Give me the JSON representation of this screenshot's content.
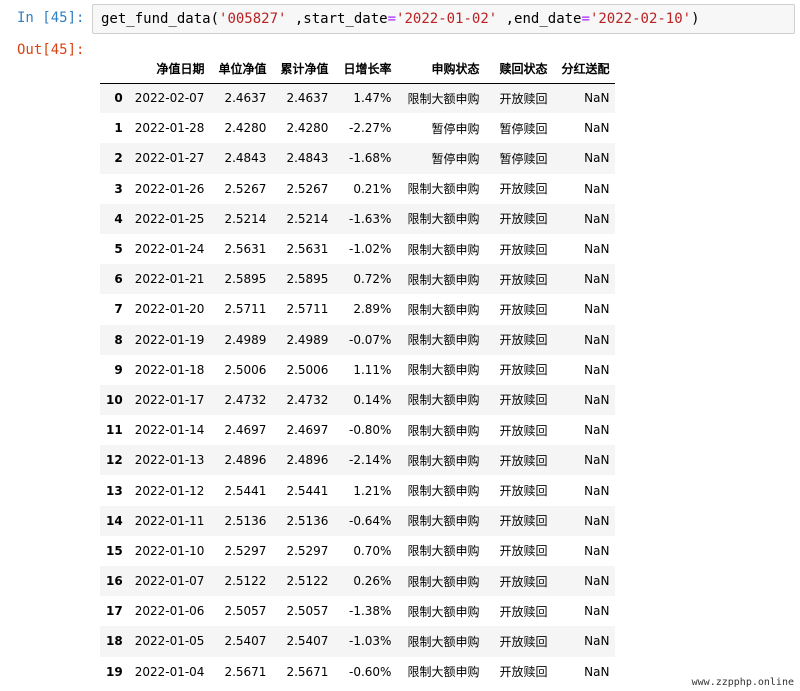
{
  "input_cell": {
    "prompt": "In [45]:",
    "code": {
      "func": "get_fund_data(",
      "arg1": "'005827'",
      "sep1": " ,start_date",
      "eq1": "=",
      "arg2": "'2022-01-02'",
      "sep2": " ,end_date",
      "eq2": "=",
      "arg3": "'2022-02-10'",
      "close": ")"
    }
  },
  "output_cell": {
    "prompt": "Out[45]:"
  },
  "table": {
    "columns": [
      "",
      "净值日期",
      "单位净值",
      "累计净值",
      "日增长率",
      "申购状态",
      "赎回状态",
      "分红送配"
    ],
    "rows": [
      [
        "0",
        "2022-02-07",
        "2.4637",
        "2.4637",
        "1.47%",
        "限制大额申购",
        "开放赎回",
        "NaN"
      ],
      [
        "1",
        "2022-01-28",
        "2.4280",
        "2.4280",
        "-2.27%",
        "暂停申购",
        "暂停赎回",
        "NaN"
      ],
      [
        "2",
        "2022-01-27",
        "2.4843",
        "2.4843",
        "-1.68%",
        "暂停申购",
        "暂停赎回",
        "NaN"
      ],
      [
        "3",
        "2022-01-26",
        "2.5267",
        "2.5267",
        "0.21%",
        "限制大额申购",
        "开放赎回",
        "NaN"
      ],
      [
        "4",
        "2022-01-25",
        "2.5214",
        "2.5214",
        "-1.63%",
        "限制大额申购",
        "开放赎回",
        "NaN"
      ],
      [
        "5",
        "2022-01-24",
        "2.5631",
        "2.5631",
        "-1.02%",
        "限制大额申购",
        "开放赎回",
        "NaN"
      ],
      [
        "6",
        "2022-01-21",
        "2.5895",
        "2.5895",
        "0.72%",
        "限制大额申购",
        "开放赎回",
        "NaN"
      ],
      [
        "7",
        "2022-01-20",
        "2.5711",
        "2.5711",
        "2.89%",
        "限制大额申购",
        "开放赎回",
        "NaN"
      ],
      [
        "8",
        "2022-01-19",
        "2.4989",
        "2.4989",
        "-0.07%",
        "限制大额申购",
        "开放赎回",
        "NaN"
      ],
      [
        "9",
        "2022-01-18",
        "2.5006",
        "2.5006",
        "1.11%",
        "限制大额申购",
        "开放赎回",
        "NaN"
      ],
      [
        "10",
        "2022-01-17",
        "2.4732",
        "2.4732",
        "0.14%",
        "限制大额申购",
        "开放赎回",
        "NaN"
      ],
      [
        "11",
        "2022-01-14",
        "2.4697",
        "2.4697",
        "-0.80%",
        "限制大额申购",
        "开放赎回",
        "NaN"
      ],
      [
        "12",
        "2022-01-13",
        "2.4896",
        "2.4896",
        "-2.14%",
        "限制大额申购",
        "开放赎回",
        "NaN"
      ],
      [
        "13",
        "2022-01-12",
        "2.5441",
        "2.5441",
        "1.21%",
        "限制大额申购",
        "开放赎回",
        "NaN"
      ],
      [
        "14",
        "2022-01-11",
        "2.5136",
        "2.5136",
        "-0.64%",
        "限制大额申购",
        "开放赎回",
        "NaN"
      ],
      [
        "15",
        "2022-01-10",
        "2.5297",
        "2.5297",
        "0.70%",
        "限制大额申购",
        "开放赎回",
        "NaN"
      ],
      [
        "16",
        "2022-01-07",
        "2.5122",
        "2.5122",
        "0.26%",
        "限制大额申购",
        "开放赎回",
        "NaN"
      ],
      [
        "17",
        "2022-01-06",
        "2.5057",
        "2.5057",
        "-1.38%",
        "限制大额申购",
        "开放赎回",
        "NaN"
      ],
      [
        "18",
        "2022-01-05",
        "2.5407",
        "2.5407",
        "-1.03%",
        "限制大额申购",
        "开放赎回",
        "NaN"
      ],
      [
        "19",
        "2022-01-04",
        "2.5671",
        "2.5671",
        "-0.60%",
        "限制大额申购",
        "开放赎回",
        "NaN"
      ]
    ]
  },
  "watermark": "www.zzpphp.online"
}
